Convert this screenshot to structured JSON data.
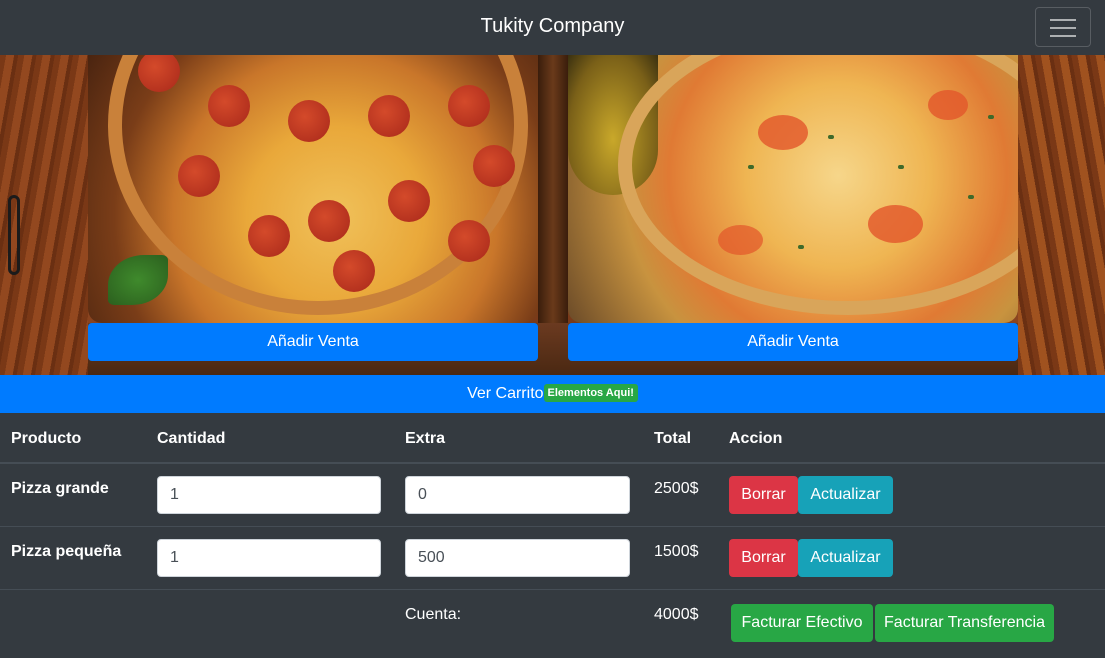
{
  "navbar": {
    "brand": "Tukity Company",
    "toggler_icon": "hamburger-icon"
  },
  "products": [
    {
      "image": "pepperoni-pizza-image",
      "button_label": "Añadir Venta"
    },
    {
      "image": "cheese-pizza-image",
      "button_label": "Añadir Venta"
    }
  ],
  "cart": {
    "label": "Ver Carrito",
    "badge": "Elementos Aqui!"
  },
  "table": {
    "headers": [
      "Producto",
      "Cantidad",
      "Extra",
      "Total",
      "Accion"
    ],
    "rows": [
      {
        "product": "Pizza grande",
        "quantity": "1",
        "extra": "0",
        "total": "2500$",
        "delete_label": "Borrar",
        "update_label": "Actualizar"
      },
      {
        "product": "Pizza pequeña",
        "quantity": "1",
        "extra": "500",
        "total": "1500$",
        "delete_label": "Borrar",
        "update_label": "Actualizar"
      }
    ],
    "footer": {
      "label": "Cuenta:",
      "total": "4000$",
      "cash_label": "Facturar Efectivo",
      "transfer_label": "Facturar Transferencia"
    }
  },
  "colors": {
    "dark": "#343a40",
    "primary": "#007bff",
    "danger": "#dc3545",
    "info": "#17a2b8",
    "success": "#28a745"
  }
}
